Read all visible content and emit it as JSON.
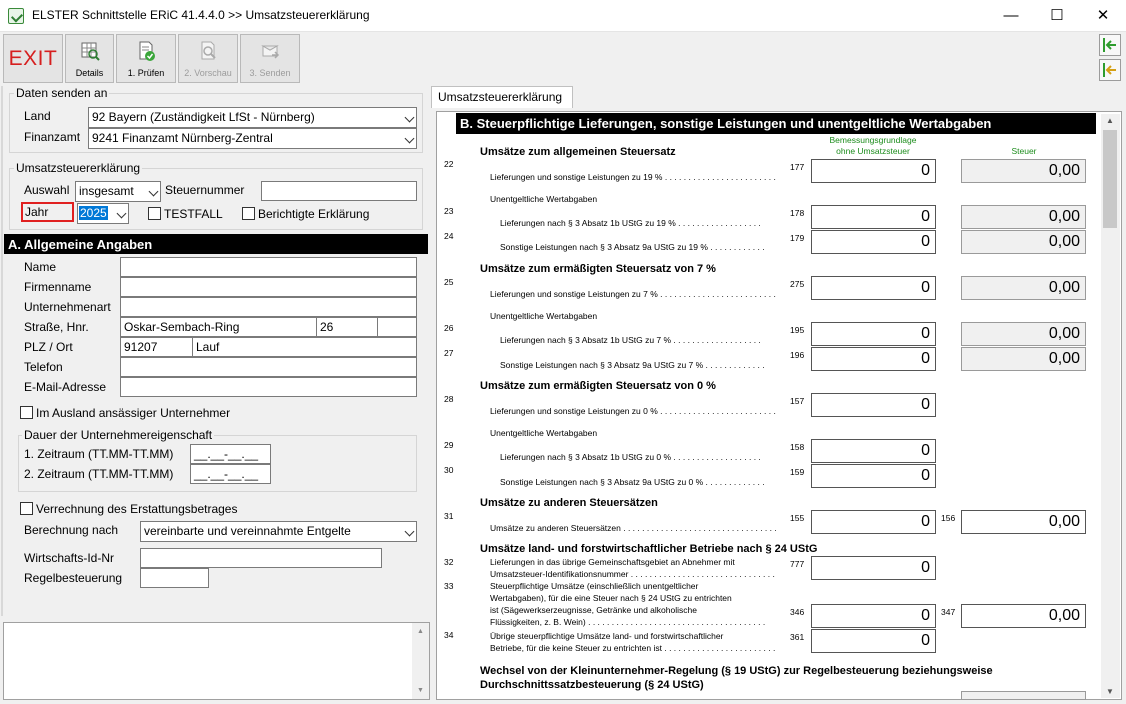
{
  "window": {
    "title": "ELSTER Schnittstelle ERiC 41.4.4.0 >> Umsatzsteuererklärung",
    "min": "—",
    "max": "☐",
    "close": "✕"
  },
  "toolbar": {
    "exit": "EXIT",
    "details": "Details",
    "pruefen": "1. Prüfen",
    "vorschau": "2. Vorschau",
    "senden": "3. Senden"
  },
  "daten_senden": {
    "legend": "Daten senden an",
    "land_label": "Land",
    "land_value": "92 Bayern (Zuständigkeit LfSt - Nürnberg)",
    "finanzamt_label": "Finanzamt",
    "finanzamt_value": "9241 Finanzamt Nürnberg-Zentral"
  },
  "ust_erklaerung": {
    "legend": "Umsatzsteuererklärung",
    "auswahl_label": "Auswahl",
    "auswahl_value": "insgesamt",
    "steuernummer_label": "Steuernummer",
    "steuernummer_value": "",
    "jahr_label": "Jahr",
    "jahr_value": "2025",
    "testfall": "TESTFALL",
    "berichtigte": "Berichtigte Erklärung"
  },
  "section_a": {
    "title": "A. Allgemeine Angaben",
    "name_label": "Name",
    "name_value": "",
    "firmenname_label": "Firmenname",
    "firmenname_value": "",
    "unternehmensart_label": "Unternehmenart",
    "unternehmensart_value": "",
    "strasse_label": "Straße, Hnr.",
    "strasse_value": "Oskar-Sembach-Ring",
    "hnr_value": "26",
    "hnr_zusatz": "",
    "plz_label": "PLZ / Ort",
    "plz_value": "91207",
    "ort_value": "Lauf",
    "telefon_label": "Telefon",
    "telefon_value": "",
    "email_label": "E-Mail-Adresse",
    "email_value": "",
    "ausland_label": "Im Ausland ansässiger Unternehmer",
    "dauer_legend": "Dauer der Unternehmereigenschaft",
    "zeitraum1_label": "1. Zeitraum (TT.MM-TT.MM)",
    "zeitraum1_value": "__.__-__.__",
    "zeitraum2_label": "2. Zeitraum (TT.MM-TT.MM)",
    "zeitraum2_value": "__.__-__.__",
    "verrechnung_label": "Verrechnung des Erstattungsbetrages",
    "berechnung_label": "Berechnung nach",
    "berechnung_value": "vereinbarte und vereinnahmte Entgelte",
    "wid_label": "Wirtschafts-Id-Nr",
    "wid_value": "",
    "regel_label": "Regelbesteuerung",
    "regel_value": ""
  },
  "tab": {
    "label": "Umsatzsteuererklärung"
  },
  "section_b": {
    "title": "B. Steuerpflichtige Lieferungen, sonstige Leistungen und unentgeltliche Wertabgaben",
    "col_bemessung": "Bemessungsgrundlage",
    "col_bemessung2": "ohne Umsatzsteuer",
    "col_steuer": "Steuer",
    "h_allgemein": "Umsätze zum allgemeinen Steuersatz",
    "h_ermaessigt7": "Umsätze zum ermäßigten Steuersatz von 7 %",
    "h_ermaessigt0": "Umsätze zum ermäßigten Steuersatz von 0 %",
    "h_andere": "Umsätze zu anderen Steuersätzen",
    "h_landforst": "Umsätze land- und forstwirtschaftlicher Betriebe nach § 24 UStG",
    "h_wechsel1": "Wechsel von der Kleinunternehmer-Regelung (§ 19 UStG) zur Regelbesteuerung beziehungsweise",
    "h_wechsel2": "Durchschnittssatzbesteuerung (§ 24 UStG)",
    "unentgeltlich": "Unentgeltliche Wertabgaben",
    "rows": {
      "r22": {
        "line": "22",
        "text": "Lieferungen und sonstige Leistungen zu 19 % . . . . . . . . . . . . . . . . . . . . . . . .",
        "kz": "177",
        "base": "0",
        "tax": "0,00"
      },
      "r23": {
        "line": "23",
        "text": "Lieferungen nach § 3 Absatz 1b UStG zu 19 % . . . . . . . . . . . . . . . . . .",
        "kz": "178",
        "base": "0",
        "tax": "0,00"
      },
      "r24": {
        "line": "24",
        "text": "Sonstige Leistungen nach § 3 Absatz 9a UStG zu 19 % . . . . . . . . . . . .",
        "kz": "179",
        "base": "0",
        "tax": "0,00"
      },
      "r25": {
        "line": "25",
        "text": "Lieferungen und sonstige Leistungen zu 7 % . . . . . . . . . . . . . . . . . . . . . . . . .",
        "kz": "275",
        "base": "0",
        "tax": "0,00"
      },
      "r26": {
        "line": "26",
        "text": "Lieferungen nach § 3 Absatz 1b UStG zu 7 % . . . . . . . . . . . . . . . . . . .",
        "kz": "195",
        "base": "0",
        "tax": "0,00"
      },
      "r27": {
        "line": "27",
        "text": "Sonstige Leistungen nach § 3 Absatz 9a UStG zu 7 % . . . . . . . . . . . . .",
        "kz": "196",
        "base": "0",
        "tax": "0,00"
      },
      "r28": {
        "line": "28",
        "text": "Lieferungen und sonstige Leistungen zu 0 % . . . . . . . . . . . . . . . . . . . . . . . . .",
        "kz": "157",
        "base": "0"
      },
      "r29": {
        "line": "29",
        "text": "Lieferungen nach § 3 Absatz 1b UStG zu 0 % . . . . . . . . . . . . . . . . . . .",
        "kz": "158",
        "base": "0"
      },
      "r30": {
        "line": "30",
        "text": "Sonstige Leistungen nach § 3 Absatz 9a UStG zu 0 % . . . . . . . . . . . . .",
        "kz": "159",
        "base": "0"
      },
      "r31": {
        "line": "31",
        "text": "Umsätze zu anderen Steuersätzen . . . . . . . . . . . . . . . . . . . . . . . . . . . . . . . . .",
        "kz": "155",
        "kz2": "156",
        "base": "0",
        "tax": "0,00"
      },
      "r32": {
        "line": "32",
        "text1": "Lieferungen in das übrige Gemeinschaftsgebiet an Abnehmer mit",
        "text2": "Umsatzsteuer-Identifikationsnummer . . . . . . . . . . . . . . . . . . . . . . . . . . . . . . .",
        "kz": "777",
        "base": "0"
      },
      "r33": {
        "line": "33",
        "text1": "Steuerpflichtige Umsätze (einschließlich unentgeltlicher",
        "text2": "Wertabgaben), für die eine Steuer nach § 24 UStG zu entrichten",
        "text3": "ist (Sägewerkserzeugnisse, Getränke und alkoholische",
        "text4": "Flüssigkeiten, z. B. Wein) . . . . . . . . . . . . . . . . . . . . . . . . . . . . . . . . . . . . . .",
        "kz": "346",
        "kz2": "347",
        "base": "0",
        "tax": "0,00"
      },
      "r34": {
        "line": "34",
        "text1": "Übrige steuerpflichtige Umsätze land- und forstwirtschaftlicher",
        "text2": "Betriebe, für die keine Steuer zu entrichten ist . . . . . . . . . . . . . . . . . . . . . . . .",
        "kz": "361",
        "base": "0"
      }
    }
  }
}
